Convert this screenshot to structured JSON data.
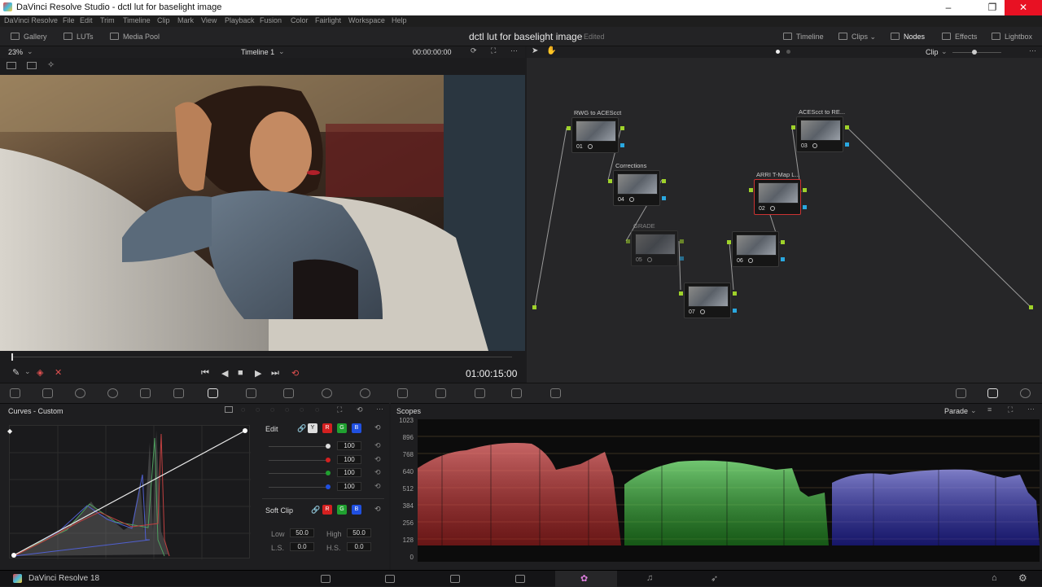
{
  "window": {
    "title": "DaVinci Resolve Studio - dctl lut for baselight image",
    "min": "–",
    "max": "❐",
    "close": "✕"
  },
  "menu": [
    "DaVinci Resolve",
    "File",
    "Edit",
    "Trim",
    "Timeline",
    "Clip",
    "Mark",
    "View",
    "Playback",
    "Fusion",
    "Color",
    "Fairlight",
    "Workspace",
    "Help"
  ],
  "toolbar": {
    "gallery": "Gallery",
    "luts": "LUTs",
    "media_pool": "Media Pool",
    "project": "dctl lut for baselight image",
    "edited": "Edited",
    "timeline": "Timeline",
    "clips": "Clips",
    "nodes": "Nodes",
    "effects": "Effects",
    "lightbox": "Lightbox"
  },
  "viewer": {
    "zoom": "23%",
    "timeline": "Timeline 1",
    "timecode_top": "00:00:00:00",
    "timecode": "01:00:15:00"
  },
  "nodes_header": {
    "mode": "Clip"
  },
  "nodes": [
    {
      "label": "RWG to ACEScct",
      "num": "01"
    },
    {
      "label": "Corrections",
      "num": "04"
    },
    {
      "label": "GRADE",
      "num": "05"
    },
    {
      "label": "ARRI T-Map L...",
      "num": "02"
    },
    {
      "label": "",
      "num": "06"
    },
    {
      "label": "",
      "num": "07"
    },
    {
      "label": "ACEScct to RE...",
      "num": "03"
    }
  ],
  "curves": {
    "title": "Curves - Custom",
    "edit": "Edit",
    "y": "Y",
    "r": "R",
    "g": "G",
    "b": "B",
    "values": [
      "100",
      "100",
      "100",
      "100"
    ],
    "soft_clip": "Soft Clip",
    "low_label": "Low",
    "low": "50.0",
    "high_label": "High",
    "high": "50.0",
    "ls_label": "L.S.",
    "ls": "0.0",
    "hs_label": "H.S.",
    "hs": "0.0"
  },
  "scopes": {
    "title": "Scopes",
    "mode": "Parade",
    "ticks": [
      "1023",
      "896",
      "768",
      "640",
      "512",
      "384",
      "256",
      "128",
      "0"
    ]
  },
  "status": {
    "app": "DaVinci Resolve 18"
  }
}
